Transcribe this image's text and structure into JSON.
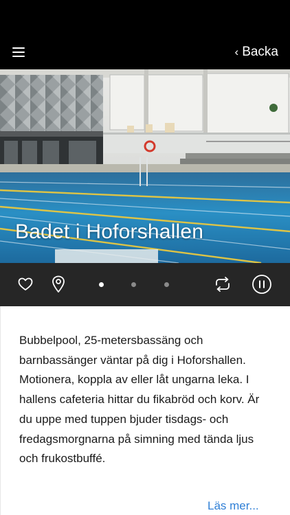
{
  "nav": {
    "menu_icon": "hamburger-menu-icon",
    "back_label": "Backa",
    "back_chevron": "‹"
  },
  "hero": {
    "title": "Badet i Hoforshallen",
    "image": "indoor-swimming-pool-photo"
  },
  "controls": {
    "favorite_icon": "heart-icon",
    "location_icon": "map-pin-icon",
    "share_icon": "repeat-arrows-icon",
    "pause_icon": "pause-circle-icon",
    "pagination": {
      "pages": 3,
      "active": 0
    },
    "colors": {
      "active_dot": "#ffffff",
      "inactive_dot": "#8a8a8a",
      "bar_bg": "#262626"
    }
  },
  "description": "Bubbelpool, 25-metersbassäng och barnbassänger väntar på dig i Hoforshallen. Motionera, koppla av eller låt ungarna leka. I hallens cafeteria hittar du fikabröd och korv. Är du uppe med tuppen bjuder tisdags- och fredagsmorgnarna på simning med tända ljus och frukostbuffé.",
  "read_more_label": "Läs mer...",
  "colors": {
    "link": "#2f7fd6",
    "nav_bg": "#000000"
  }
}
